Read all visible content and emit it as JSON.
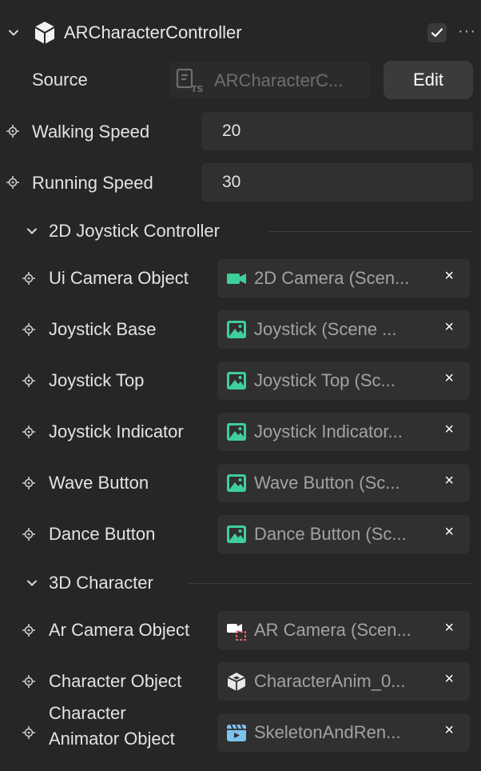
{
  "component": {
    "title": "ARCharacterController",
    "enabled": true,
    "more_label": "···"
  },
  "source": {
    "label": "Source",
    "value": "ARCharacterC...",
    "edit_label": "Edit"
  },
  "fields": {
    "walking_speed": {
      "label": "Walking Speed",
      "value": "20"
    },
    "running_speed": {
      "label": "Running Speed",
      "value": "30"
    }
  },
  "sections": {
    "joystick": {
      "title": "2D Joystick Controller",
      "rows": [
        {
          "label": "Ui Camera Object",
          "value": "2D Camera (Scen...",
          "icon": "camera-icon"
        },
        {
          "label": "Joystick Base",
          "value": "Joystick (Scene ...",
          "icon": "image-icon"
        },
        {
          "label": "Joystick Top",
          "value": "Joystick Top (Sc...",
          "icon": "image-icon"
        },
        {
          "label": "Joystick Indicator",
          "value": "Joystick Indicator...",
          "icon": "image-icon"
        },
        {
          "label": "Wave Button",
          "value": "Wave Button (Sc...",
          "icon": "image-icon"
        },
        {
          "label": "Dance Button",
          "value": "Dance Button (Sc...",
          "icon": "image-icon"
        }
      ]
    },
    "character": {
      "title": "3D Character",
      "rows": [
        {
          "label": "Ar Camera Object",
          "value": "AR Camera (Scen...",
          "icon": "ar-camera-icon"
        },
        {
          "label": "Character Object",
          "value": "CharacterAnim_0...",
          "icon": "object-icon"
        },
        {
          "label": "Character\nAnimator Object",
          "value": "SkeletonAndRen...",
          "icon": "animator-icon"
        }
      ]
    }
  },
  "clear_label": "×",
  "colors": {
    "accent_green": "#3ecf9b",
    "accent_blue": "#7cc3ee",
    "panel_bg": "#262626",
    "field_bg": "#303030"
  }
}
